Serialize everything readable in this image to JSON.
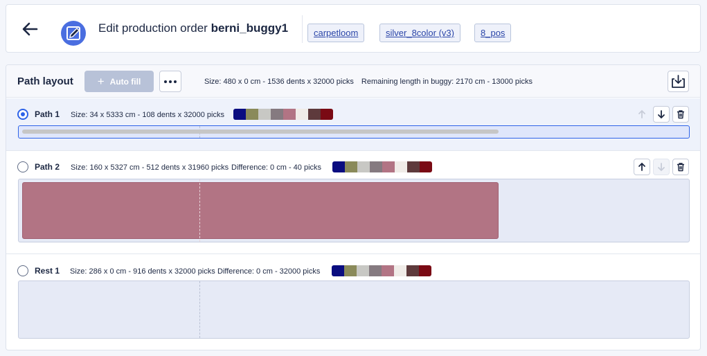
{
  "header": {
    "title_prefix": "Edit production order",
    "title_name": "berni_buggy1",
    "tags": [
      "carpetloom",
      "silver_8color (v3)",
      "8_pos"
    ]
  },
  "toolbar": {
    "title": "Path layout",
    "autofill_label": "Auto fill",
    "size_text": "Size: 480 x 0 cm - 1536 dents x 32000 picks",
    "remaining_text": "Remaining length in buggy: 2170 cm - 13000 picks"
  },
  "palette": [
    "#0a0d80",
    "#8a8a5a",
    "#c8c8c4",
    "#857a80",
    "#b27484",
    "#f0ece8",
    "#5e3a3c",
    "#7a0a14"
  ],
  "paths": [
    {
      "name": "Path 1",
      "size": "Size: 34 x 5333 cm - 108 dents x 32000 picks",
      "difference": "",
      "selected": true,
      "fill_color": "#c6c6c6"
    },
    {
      "name": "Path 2",
      "size": "Size: 160 x 5327 cm - 512 dents x 31960 picks",
      "difference": "Difference: 0 cm - 40 picks",
      "selected": false,
      "fill_color": "#b27484"
    },
    {
      "name": "Rest 1",
      "size": "Size: 286 x 0 cm - 916 dents x 32000 picks",
      "difference": "Difference: 0 cm - 32000 picks",
      "selected": false,
      "fill_color": ""
    }
  ]
}
